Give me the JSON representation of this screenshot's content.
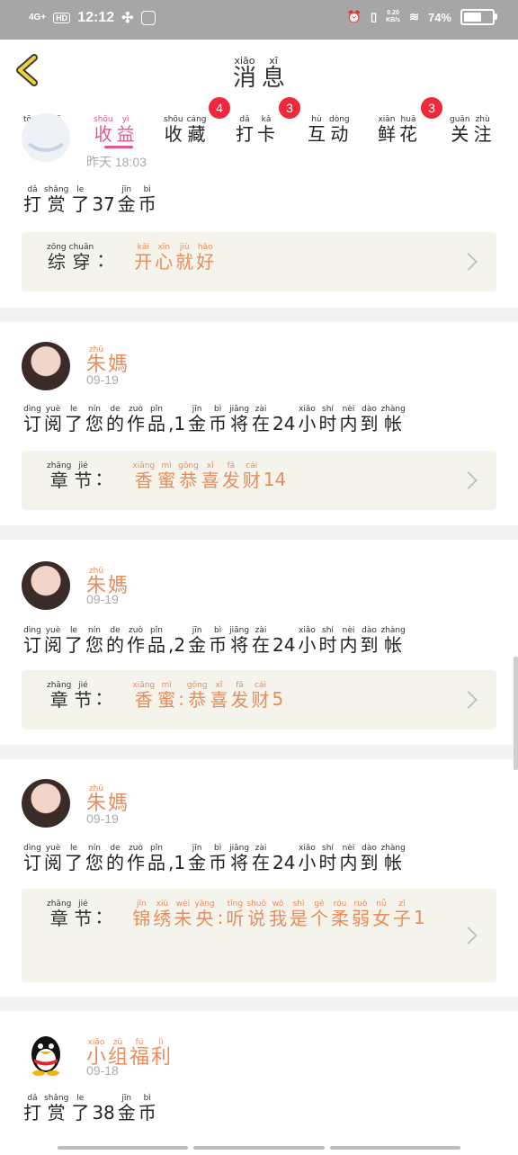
{
  "status_bar": {
    "signal": "4G+",
    "hd": "HD",
    "time": "12:12",
    "net_speed": "0.20",
    "net_unit": "KB/s",
    "battery": "74%",
    "battery_level": 0.74
  },
  "header": {
    "title": [
      {
        "py": "xiāo",
        "hz": "消"
      },
      {
        "py": "xī",
        "hz": "息"
      }
    ]
  },
  "tabs": [
    {
      "chars": [
        {
          "py": "tōng",
          "hz": "通"
        },
        {
          "py": "zhī",
          "hz": "知"
        }
      ],
      "badge": ""
    },
    {
      "chars": [
        {
          "py": "shōu",
          "hz": "收"
        },
        {
          "py": "yì",
          "hz": "益"
        }
      ],
      "badge": "",
      "active": true
    },
    {
      "chars": [
        {
          "py": "shōu",
          "hz": "收"
        },
        {
          "py": "cáng",
          "hz": "藏"
        }
      ],
      "badge": "4"
    },
    {
      "chars": [
        {
          "py": "dǎ",
          "hz": "打"
        },
        {
          "py": "kǎ",
          "hz": "卡"
        }
      ],
      "badge": "3"
    },
    {
      "chars": [
        {
          "py": "hù",
          "hz": "互"
        },
        {
          "py": "dòng",
          "hz": "动"
        }
      ],
      "badge": ""
    },
    {
      "chars": [
        {
          "py": "xiān",
          "hz": "鲜"
        },
        {
          "py": "huā",
          "hz": "花"
        }
      ],
      "badge": "3"
    },
    {
      "chars": [
        {
          "py": "guān",
          "hz": "关"
        },
        {
          "py": "zhù",
          "hz": "注"
        }
      ],
      "badge": ""
    }
  ],
  "items": [
    {
      "date": "昨天 18:03",
      "message": [
        {
          "py": "dǎ",
          "hz": "打"
        },
        {
          "py": "shǎng",
          "hz": "赏"
        },
        {
          "py": "le",
          "hz": "了"
        },
        {
          "text": "37"
        },
        {
          "py": "jīn",
          "hz": "金"
        },
        {
          "py": "bì",
          "hz": "币"
        }
      ],
      "quote_label": [
        {
          "py": "zōng",
          "hz": "综"
        },
        {
          "py": "chuān",
          "hz": "穿"
        },
        {
          "text": "："
        }
      ],
      "quote": [
        {
          "py": "kāi",
          "hz": "开"
        },
        {
          "py": "xīn",
          "hz": "心"
        },
        {
          "py": "jiù",
          "hz": "就"
        },
        {
          "py": "hǎo",
          "hz": "好"
        }
      ]
    },
    {
      "user": [
        {
          "py": "zhū",
          "hz": "朱"
        },
        {
          "py": "",
          "hz": "媽"
        }
      ],
      "date": "09-19",
      "message": [
        {
          "py": "dìng",
          "hz": "订"
        },
        {
          "py": "yuè",
          "hz": "阅"
        },
        {
          "py": "le",
          "hz": "了"
        },
        {
          "py": "nín",
          "hz": "您"
        },
        {
          "py": "de",
          "hz": "的"
        },
        {
          "py": "zuò",
          "hz": "作"
        },
        {
          "py": "pǐn",
          "hz": "品"
        },
        {
          "text": ",1"
        },
        {
          "py": "jīn",
          "hz": "金"
        },
        {
          "py": "bì",
          "hz": "币"
        },
        {
          "py": "jiāng",
          "hz": "将"
        },
        {
          "py": "zài",
          "hz": "在"
        },
        {
          "text": "24"
        },
        {
          "py": "xiǎo",
          "hz": "小"
        },
        {
          "py": "shí",
          "hz": "时"
        },
        {
          "py": "nèi",
          "hz": "内"
        },
        {
          "py": "dào",
          "hz": "到"
        },
        {
          "py": "zhàng",
          "hz": "帐"
        }
      ],
      "quote_label": [
        {
          "py": "zhāng",
          "hz": "章"
        },
        {
          "py": "jié",
          "hz": "节"
        },
        {
          "text": "："
        }
      ],
      "quote": [
        {
          "py": "xiāng",
          "hz": "香"
        },
        {
          "py": "mì",
          "hz": "蜜"
        },
        {
          "py": "gōng",
          "hz": "恭"
        },
        {
          "py": "xǐ",
          "hz": "喜"
        },
        {
          "py": "fā",
          "hz": "发"
        },
        {
          "py": "cái",
          "hz": "财"
        },
        {
          "text": "14"
        }
      ]
    },
    {
      "user": [
        {
          "py": "zhū",
          "hz": "朱"
        },
        {
          "py": "",
          "hz": "媽"
        }
      ],
      "date": "09-19",
      "message": [
        {
          "py": "dìng",
          "hz": "订"
        },
        {
          "py": "yuè",
          "hz": "阅"
        },
        {
          "py": "le",
          "hz": "了"
        },
        {
          "py": "nín",
          "hz": "您"
        },
        {
          "py": "de",
          "hz": "的"
        },
        {
          "py": "zuò",
          "hz": "作"
        },
        {
          "py": "pǐn",
          "hz": "品"
        },
        {
          "text": ",2"
        },
        {
          "py": "jīn",
          "hz": "金"
        },
        {
          "py": "bì",
          "hz": "币"
        },
        {
          "py": "jiāng",
          "hz": "将"
        },
        {
          "py": "zài",
          "hz": "在"
        },
        {
          "text": "24"
        },
        {
          "py": "xiǎo",
          "hz": "小"
        },
        {
          "py": "shí",
          "hz": "时"
        },
        {
          "py": "nèi",
          "hz": "内"
        },
        {
          "py": "dào",
          "hz": "到"
        },
        {
          "py": "zhàng",
          "hz": "帐"
        }
      ],
      "quote_label": [
        {
          "py": "zhāng",
          "hz": "章"
        },
        {
          "py": "jié",
          "hz": "节"
        },
        {
          "text": "："
        }
      ],
      "quote": [
        {
          "py": "xiāng",
          "hz": "香"
        },
        {
          "py": "mì",
          "hz": "蜜"
        },
        {
          "text": ":"
        },
        {
          "py": "gōng",
          "hz": "恭"
        },
        {
          "py": "xǐ",
          "hz": "喜"
        },
        {
          "py": "fā",
          "hz": "发"
        },
        {
          "py": "cái",
          "hz": "财"
        },
        {
          "text": "5"
        }
      ]
    },
    {
      "user": [
        {
          "py": "zhū",
          "hz": "朱"
        },
        {
          "py": "",
          "hz": "媽"
        }
      ],
      "date": "09-19",
      "message": [
        {
          "py": "dìng",
          "hz": "订"
        },
        {
          "py": "yuè",
          "hz": "阅"
        },
        {
          "py": "le",
          "hz": "了"
        },
        {
          "py": "nín",
          "hz": "您"
        },
        {
          "py": "de",
          "hz": "的"
        },
        {
          "py": "zuò",
          "hz": "作"
        },
        {
          "py": "pǐn",
          "hz": "品"
        },
        {
          "text": ",1"
        },
        {
          "py": "jīn",
          "hz": "金"
        },
        {
          "py": "bì",
          "hz": "币"
        },
        {
          "py": "jiāng",
          "hz": "将"
        },
        {
          "py": "zài",
          "hz": "在"
        },
        {
          "text": "24"
        },
        {
          "py": "xiǎo",
          "hz": "小"
        },
        {
          "py": "shí",
          "hz": "时"
        },
        {
          "py": "nèi",
          "hz": "内"
        },
        {
          "py": "dào",
          "hz": "到"
        },
        {
          "py": "zhàng",
          "hz": "帐"
        }
      ],
      "quote_label": [
        {
          "py": "zhāng",
          "hz": "章"
        },
        {
          "py": "jié",
          "hz": "节"
        },
        {
          "text": "："
        }
      ],
      "quote": [
        {
          "py": "jǐn",
          "hz": "锦"
        },
        {
          "py": "xiù",
          "hz": "绣"
        },
        {
          "py": "wèi",
          "hz": "未"
        },
        {
          "py": "yāng",
          "hz": "央"
        },
        {
          "text": ":"
        },
        {
          "py": "tīng",
          "hz": "听"
        },
        {
          "py": "shuō",
          "hz": "说"
        },
        {
          "py": "wǒ",
          "hz": "我"
        },
        {
          "py": "shì",
          "hz": "是"
        },
        {
          "py": "gè",
          "hz": "个"
        },
        {
          "py": "róu",
          "hz": "柔"
        },
        {
          "py": "ruò",
          "hz": "弱"
        },
        {
          "py": "nǚ",
          "hz": "女"
        },
        {
          "py": "zǐ",
          "hz": "子"
        },
        {
          "text": "1"
        }
      ]
    },
    {
      "user": [
        {
          "py": "xiǎo",
          "hz": "小"
        },
        {
          "py": "zǔ",
          "hz": "组"
        },
        {
          "py": "fú",
          "hz": "福"
        },
        {
          "py": "lì",
          "hz": "利"
        }
      ],
      "date": "09-18",
      "message": [
        {
          "py": "dǎ",
          "hz": "打"
        },
        {
          "py": "shǎng",
          "hz": "赏"
        },
        {
          "py": "le",
          "hz": "了"
        },
        {
          "text": "38"
        },
        {
          "py": "jīn",
          "hz": "金"
        },
        {
          "py": "bì",
          "hz": "币"
        }
      ]
    }
  ]
}
